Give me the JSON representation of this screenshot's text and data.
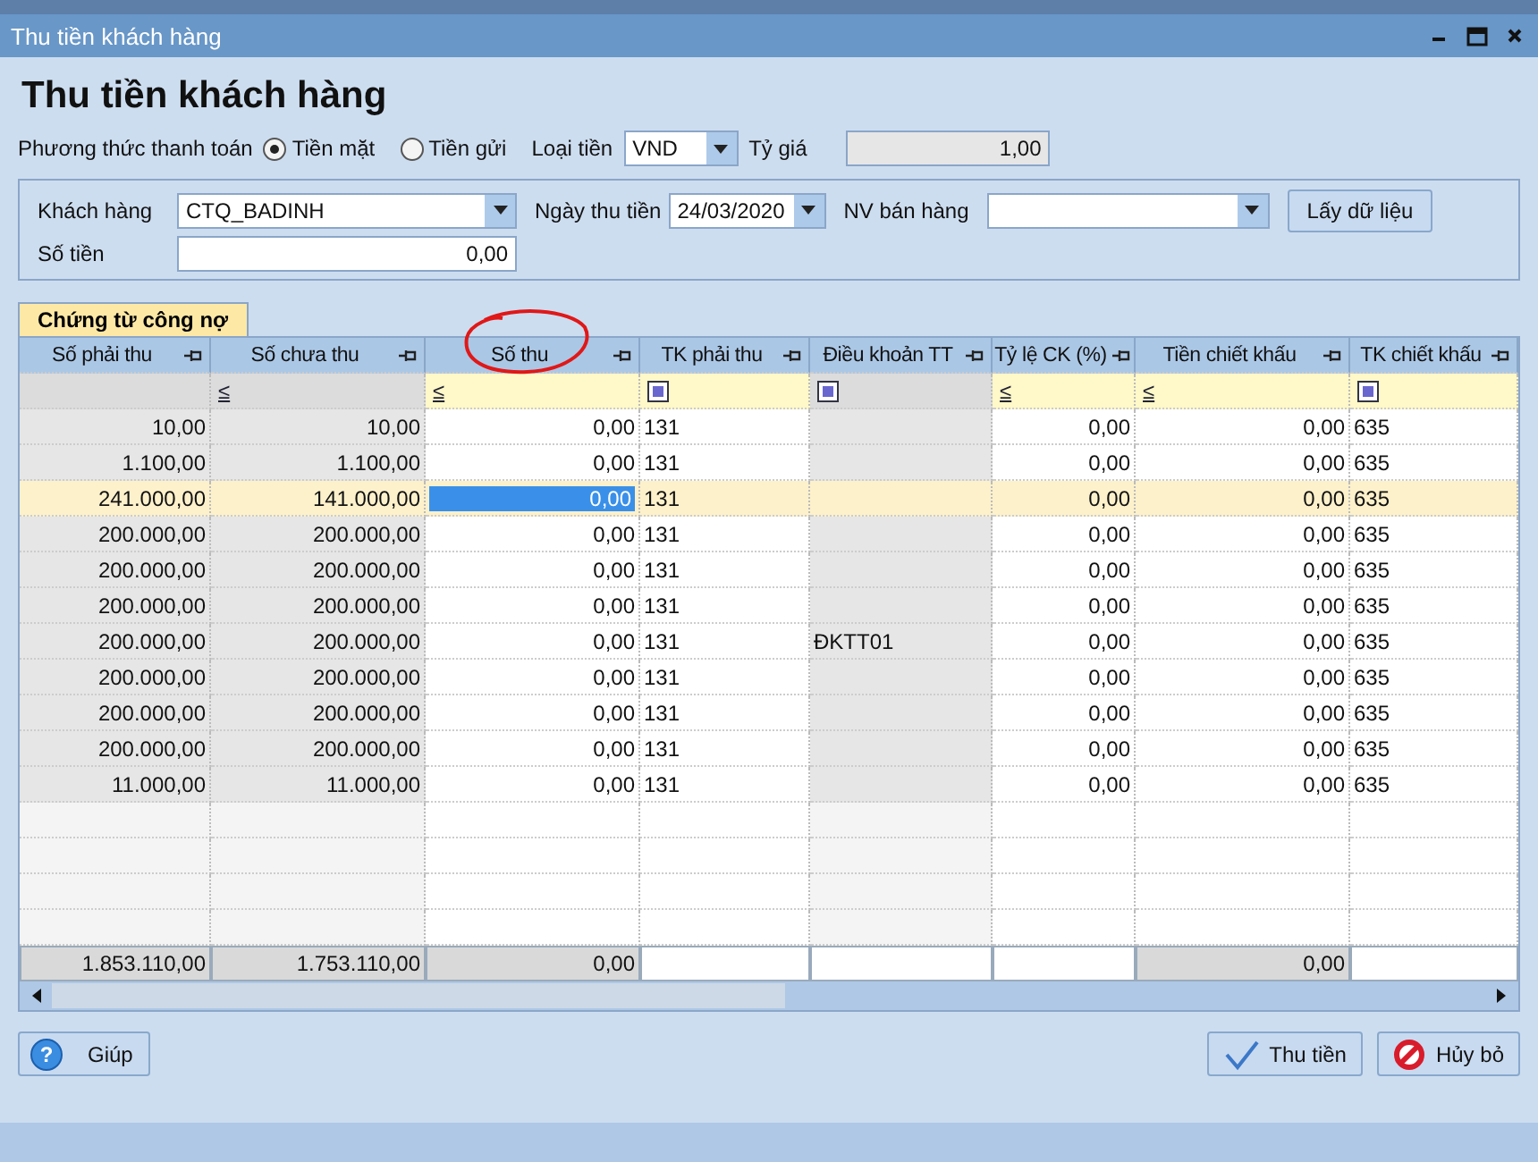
{
  "window": {
    "title": "Thu tiền khách hàng"
  },
  "heading": "Thu tiền khách hàng",
  "payment": {
    "label": "Phương thức thanh toán",
    "options": [
      {
        "label": "Tiền mặt",
        "selected": true
      },
      {
        "label": "Tiền gửi",
        "selected": false
      }
    ],
    "currency_label": "Loại tiền",
    "currency": "VND",
    "rate_label": "Tỷ giá",
    "rate": "1,00"
  },
  "filter": {
    "customer_label": "Khách hàng",
    "customer": "CTQ_BADINH",
    "date_label": "Ngày thu tiền",
    "date": "24/03/2020",
    "staff_label": "NV bán hàng",
    "load_button": "Lấy dữ liệu",
    "amount_label": "Số tiền",
    "amount": "0,00"
  },
  "tab": {
    "label": "Chứng từ công nợ",
    "selected": true
  },
  "table": {
    "columns": [
      {
        "label": "Số phải thu",
        "kind": "amount",
        "editable": false,
        "total": "1.853.110,00"
      },
      {
        "label": "Số chưa thu",
        "kind": "amount",
        "editable": false,
        "filter": {
          "kind": "op",
          "text": "≤"
        },
        "total": "1.753.110,00"
      },
      {
        "label": "Số thu",
        "kind": "amount",
        "editable": true,
        "filter": {
          "kind": "op",
          "text": "≤"
        },
        "total": "0,00"
      },
      {
        "label": "TK phải thu",
        "kind": "account",
        "editable": true,
        "filter": {
          "kind": "check"
        }
      },
      {
        "label": "Điều khoản TT",
        "kind": "account",
        "editable": false,
        "filter": {
          "kind": "check"
        }
      },
      {
        "label": "Tỷ lệ CK (%)",
        "kind": "amount",
        "editable": true,
        "filter": {
          "kind": "op",
          "text": "≤"
        }
      },
      {
        "label": "Tiền chiết khấu",
        "kind": "amount",
        "editable": true,
        "filter": {
          "kind": "op",
          "text": "≤"
        },
        "total": "0,00"
      },
      {
        "label": "TK chiết khấu",
        "kind": "account",
        "editable": true,
        "filter": {
          "kind": "check"
        }
      }
    ],
    "rows": [
      {
        "selected": false,
        "receivable": "10,00",
        "outstanding": "10,00",
        "collected": "0,00",
        "receivable_account": "131",
        "discount_rate": "0,00",
        "discount_amount": "0,00",
        "discount_account": "635"
      },
      {
        "selected": false,
        "receivable": "1.100,00",
        "outstanding": "1.100,00",
        "collected": "0,00",
        "receivable_account": "131",
        "discount_rate": "0,00",
        "discount_amount": "0,00",
        "discount_account": "635"
      },
      {
        "selected": true,
        "receivable": "241.000,00",
        "outstanding": "141.000,00",
        "collected": "0,00",
        "receivable_account": "131",
        "discount_rate": "0,00",
        "discount_amount": "0,00",
        "discount_account": "635"
      },
      {
        "selected": false,
        "receivable": "200.000,00",
        "outstanding": "200.000,00",
        "collected": "0,00",
        "receivable_account": "131",
        "discount_rate": "0,00",
        "discount_amount": "0,00",
        "discount_account": "635"
      },
      {
        "selected": false,
        "receivable": "200.000,00",
        "outstanding": "200.000,00",
        "collected": "0,00",
        "receivable_account": "131",
        "discount_rate": "0,00",
        "discount_amount": "0,00",
        "discount_account": "635"
      },
      {
        "selected": false,
        "receivable": "200.000,00",
        "outstanding": "200.000,00",
        "collected": "0,00",
        "receivable_account": "131",
        "discount_rate": "0,00",
        "discount_amount": "0,00",
        "discount_account": "635"
      },
      {
        "selected": false,
        "receivable": "200.000,00",
        "outstanding": "200.000,00",
        "collected": "0,00",
        "receivable_account": "131",
        "payment_terms": "ĐKTT01",
        "discount_rate": "0,00",
        "discount_amount": "0,00",
        "discount_account": "635"
      },
      {
        "selected": false,
        "receivable": "200.000,00",
        "outstanding": "200.000,00",
        "collected": "0,00",
        "receivable_account": "131",
        "discount_rate": "0,00",
        "discount_amount": "0,00",
        "discount_account": "635"
      },
      {
        "selected": false,
        "receivable": "200.000,00",
        "outstanding": "200.000,00",
        "collected": "0,00",
        "receivable_account": "131",
        "discount_rate": "0,00",
        "discount_amount": "0,00",
        "discount_account": "635"
      },
      {
        "selected": false,
        "receivable": "200.000,00",
        "outstanding": "200.000,00",
        "collected": "0,00",
        "receivable_account": "131",
        "discount_rate": "0,00",
        "discount_amount": "0,00",
        "discount_account": "635"
      },
      {
        "selected": false,
        "receivable": "11.000,00",
        "outstanding": "11.000,00",
        "collected": "0,00",
        "receivable_account": "131",
        "discount_rate": "0,00",
        "discount_amount": "0,00",
        "discount_account": "635"
      }
    ]
  },
  "buttons": {
    "help": "Giúp",
    "help_icon": "?",
    "collect": "Thu tiền",
    "cancel": "Hủy bỏ"
  }
}
